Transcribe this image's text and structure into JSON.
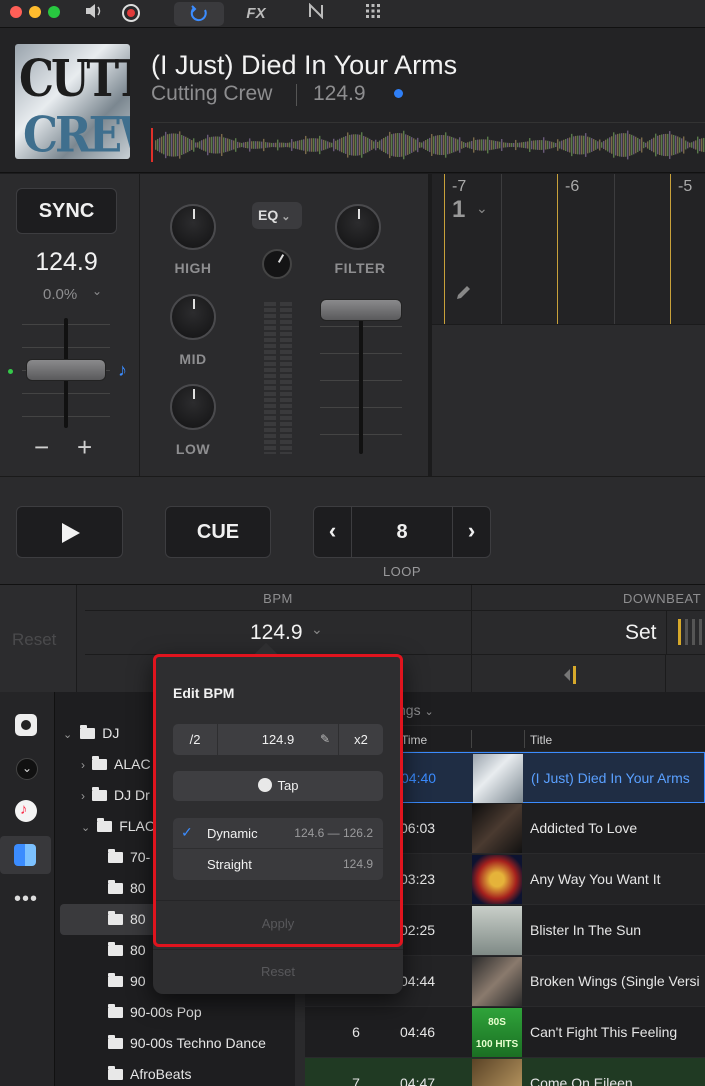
{
  "toolbar": {
    "traffic_lights": [
      "#ff5f57",
      "#febc2e",
      "#28c840"
    ],
    "fx_label": "FX"
  },
  "track": {
    "cover_text_top": "CUTTING",
    "cover_text_bottom": "CREW",
    "title": "(I Just) Died In Your Arms",
    "artist": "Cutting Crew",
    "bpm": "124.9"
  },
  "deck": {
    "sync_label": "SYNC",
    "tempo": "124.9",
    "pitch": "0.0%",
    "minus": "−",
    "plus": "+",
    "eq_button": "EQ",
    "high": "HIGH",
    "mid": "MID",
    "low": "LOW",
    "filter": "FILTER",
    "beat_markers": [
      "-7",
      "-6",
      "-5"
    ],
    "beat_number": "1"
  },
  "transport": {
    "cue_label": "CUE",
    "loop_value": "8",
    "loop_label": "LOOP"
  },
  "bpm_bar": {
    "reset": "Reset",
    "bpm_header": "BPM",
    "bpm_value": "124.9",
    "downbeat_header": "DOWNBEAT",
    "set_label": "Set"
  },
  "tree": {
    "root": "DJ",
    "items": [
      {
        "label": "ALAC"
      },
      {
        "label": "DJ Dr"
      },
      {
        "label": "FLAC"
      },
      {
        "label": "70-"
      },
      {
        "label": "80"
      },
      {
        "label": "80"
      },
      {
        "label": "80"
      },
      {
        "label": "90"
      },
      {
        "label": "90-00s Pop"
      },
      {
        "label": "90-00s Techno Dance"
      },
      {
        "label": "AfroBeats"
      }
    ]
  },
  "tracklist": {
    "header_dropdown": "ngs",
    "col_time": "Time",
    "col_title": "Title",
    "rows": [
      {
        "num": "",
        "time": "04:40",
        "title": "(I Just) Died In Your Arms"
      },
      {
        "num": "",
        "time": "06:03",
        "title": "Addicted To Love"
      },
      {
        "num": "",
        "time": "03:23",
        "title": "Any Way You Want It"
      },
      {
        "num": "",
        "time": "02:25",
        "title": "Blister In The Sun"
      },
      {
        "num": "",
        "time": "04:44",
        "title": "Broken Wings (Single Versi"
      },
      {
        "num": "6",
        "time": "04:46",
        "title": "Can't Fight This Feeling"
      },
      {
        "num": "7",
        "time": "04:47",
        "title": "Come On Eileen"
      }
    ],
    "thumb6_text": "80S\n100 HITS"
  },
  "popover": {
    "title": "Edit BPM",
    "half": "/2",
    "value": "124.9",
    "double": "x2",
    "tap": "Tap",
    "dynamic": "Dynamic",
    "dynamic_range": "124.6 — 126.2",
    "straight": "Straight",
    "straight_value": "124.9",
    "apply": "Apply",
    "reset": "Reset"
  }
}
